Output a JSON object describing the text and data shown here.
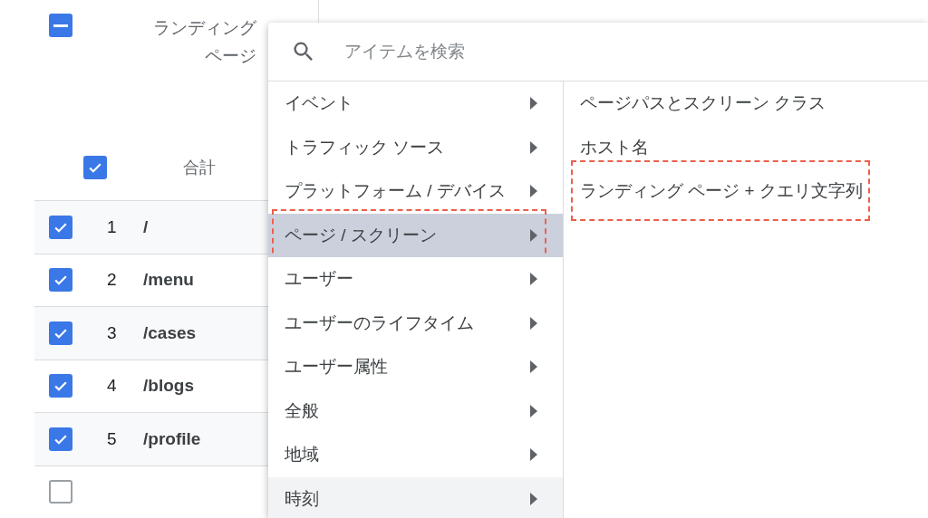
{
  "table": {
    "header": {
      "select_all_indeterminate": true,
      "column_title": "ランディングページ"
    },
    "total": {
      "checked": true,
      "label": "合計"
    },
    "rows": [
      {
        "checked": true,
        "index": "1",
        "path": "/"
      },
      {
        "checked": true,
        "index": "2",
        "path": "/menu"
      },
      {
        "checked": true,
        "index": "3",
        "path": "/cases"
      },
      {
        "checked": true,
        "index": "4",
        "path": "/blogs"
      },
      {
        "checked": true,
        "index": "5",
        "path": "/profile"
      },
      {
        "checked": false
      }
    ]
  },
  "menu": {
    "search": {
      "placeholder": "アイテムを検索"
    },
    "categories": [
      {
        "label": "イベント",
        "selected": false,
        "hovered": false,
        "annotated": false
      },
      {
        "label": "トラフィック ソース",
        "selected": false,
        "hovered": false,
        "annotated": false
      },
      {
        "label": "プラットフォーム / デバイス",
        "selected": false,
        "hovered": false,
        "annotated": false
      },
      {
        "label": "ページ / スクリーン",
        "selected": true,
        "hovered": false,
        "annotated": true
      },
      {
        "label": "ユーザー",
        "selected": false,
        "hovered": false,
        "annotated": false
      },
      {
        "label": "ユーザーのライフタイム",
        "selected": false,
        "hovered": false,
        "annotated": false
      },
      {
        "label": "ユーザー属性",
        "selected": false,
        "hovered": false,
        "annotated": false
      },
      {
        "label": "全般",
        "selected": false,
        "hovered": false,
        "annotated": false
      },
      {
        "label": "地域",
        "selected": false,
        "hovered": false,
        "annotated": false
      },
      {
        "label": "時刻",
        "selected": false,
        "hovered": true,
        "annotated": false
      }
    ],
    "options": [
      {
        "label": "ページパスとスクリーン クラス",
        "annotated": false
      },
      {
        "label": "ホスト名",
        "annotated": false
      },
      {
        "label": "ランディング ページ + クエリ文字列",
        "annotated": true
      }
    ]
  }
}
